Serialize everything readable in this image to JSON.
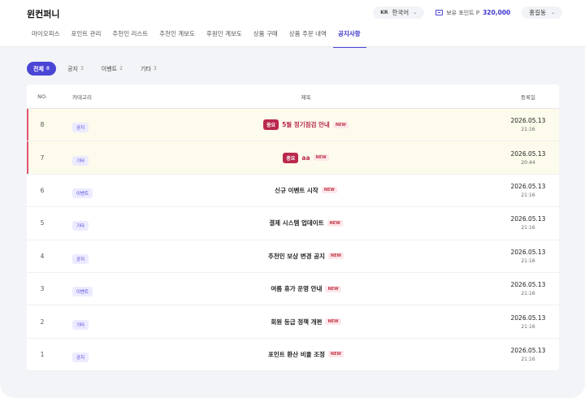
{
  "header": {
    "brand": "윈컨퍼니",
    "lang": {
      "code": "KR",
      "label": "한국어"
    },
    "points": {
      "label": "보유 포인트 P",
      "value": "320,000"
    },
    "user": "홍길동"
  },
  "nav": [
    "마이오피스",
    "포인트 관리",
    "추천인 리스트",
    "추천인 계보도",
    "후원인 계보도",
    "상품 구매",
    "상품 주문 내역",
    "공지사항"
  ],
  "nav_active": "공지사항",
  "filters": [
    {
      "label": "전체",
      "count": "8"
    },
    {
      "label": "공지",
      "count": "3"
    },
    {
      "label": "이벤트",
      "count": "2"
    },
    {
      "label": "기타",
      "count": "3"
    }
  ],
  "table": {
    "headers": {
      "no": "NO.",
      "category": "카테고리",
      "title": "제목",
      "date": "등록일"
    },
    "important_label": "중요",
    "new_label": "NEW",
    "rows": [
      {
        "no": "8",
        "category": "공지",
        "title": "5월 정기점검 안내",
        "date": "2026.05.13",
        "time": "21:16",
        "important": true
      },
      {
        "no": "7",
        "category": "기타",
        "title": "aa",
        "date": "2026.05.13",
        "time": "20:44",
        "important": true
      },
      {
        "no": "6",
        "category": "이벤트",
        "title": "신규 이벤트 시작",
        "date": "2026.05.13",
        "time": "21:16",
        "important": false
      },
      {
        "no": "5",
        "category": "기타",
        "title": "결제 시스템 업데이트",
        "date": "2026.05.13",
        "time": "21:16",
        "important": false
      },
      {
        "no": "4",
        "category": "공지",
        "title": "추천인 보상 변경 공지",
        "date": "2026.05.13",
        "time": "21:16",
        "important": false
      },
      {
        "no": "3",
        "category": "이벤트",
        "title": "여름 휴가 운영 안내",
        "date": "2026.05.13",
        "time": "21:16",
        "important": false
      },
      {
        "no": "2",
        "category": "기타",
        "title": "회원 등급 정책 개편",
        "date": "2026.05.13",
        "time": "21:16",
        "important": false
      },
      {
        "no": "1",
        "category": "공지",
        "title": "포인트 환산 비율 조정",
        "date": "2026.05.13",
        "time": "21:16",
        "important": false
      }
    ]
  },
  "colors": {
    "accent": "#4b45d6",
    "important": "#b9294d",
    "pinned_bg": "#fdfbeb"
  }
}
